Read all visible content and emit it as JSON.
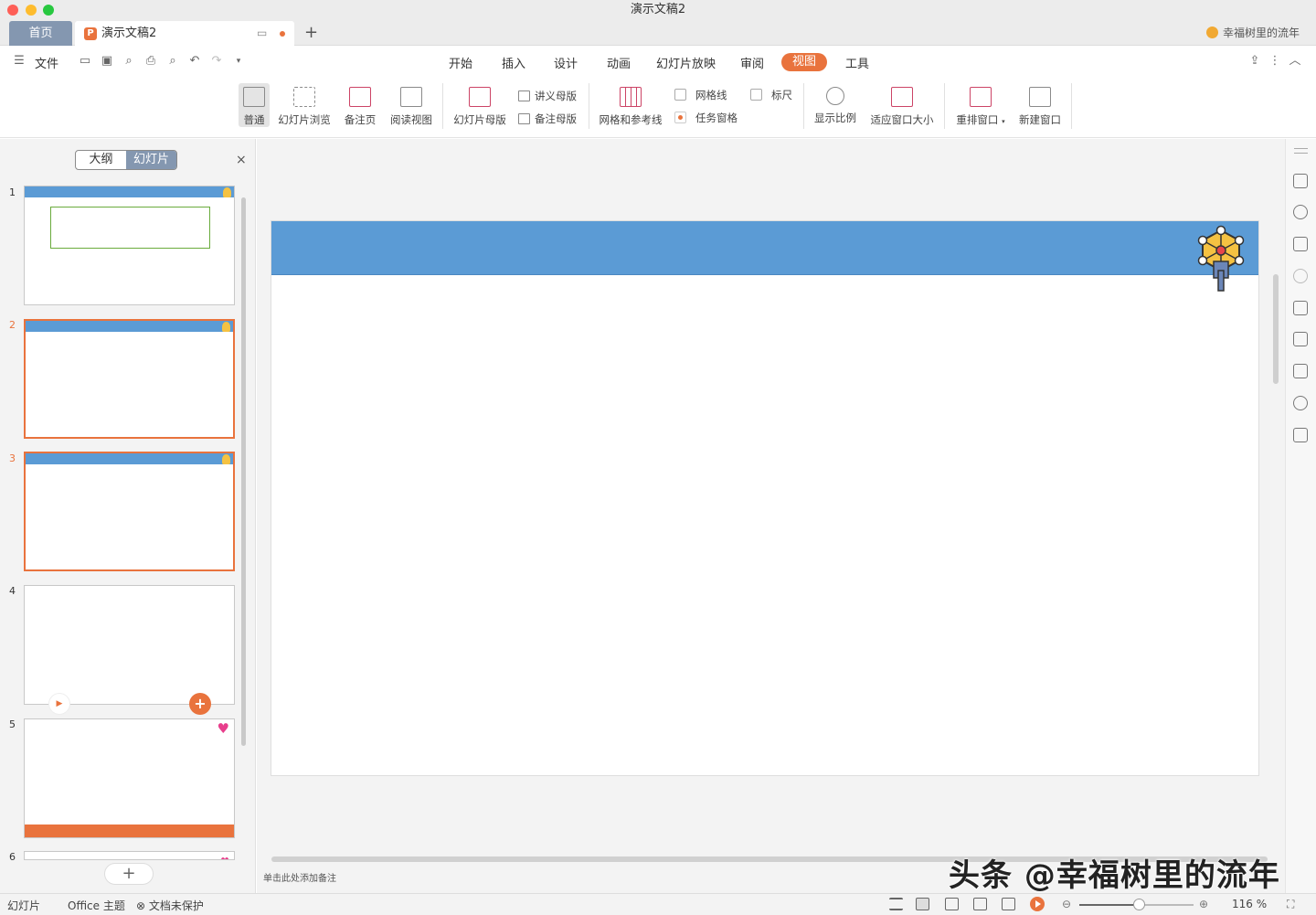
{
  "window": {
    "title": "演示文稿2"
  },
  "tabs": {
    "home": "首页",
    "doc": "演示文稿2",
    "add": "+"
  },
  "user": {
    "name": "幸福树里的流年"
  },
  "menu": {
    "file": "文件",
    "items": [
      "开始",
      "插入",
      "设计",
      "动画",
      "幻灯片放映",
      "审阅",
      "视图",
      "工具"
    ],
    "active": "视图"
  },
  "ribbon": {
    "normal": "普通",
    "slide_sorter": "幻灯片浏览",
    "notes_page": "备注页",
    "reading_view": "阅读视图",
    "slide_master": "幻灯片母版",
    "handout_master": "讲义母版",
    "notes_master": "备注母版",
    "grid_guides": "网格和参考线",
    "gridlines": "网格线",
    "task_pane": "任务窗格",
    "ruler": "标尺",
    "zoom": "显示比例",
    "fit_window": "适应窗口大小",
    "arrange": "重排窗口",
    "new_window": "新建窗口"
  },
  "left_panel": {
    "outline_tab": "大纲",
    "slides_tab": "幻灯片",
    "close": "×",
    "add_slide": "+",
    "slide_numbers": [
      "1",
      "2",
      "3",
      "4",
      "5",
      "6"
    ]
  },
  "notes_placeholder": "单击此处添加备注",
  "status": {
    "mode": "幻灯片",
    "theme": "Office 主题",
    "protect": "文档未保护",
    "zoom": "116 %",
    "zoom_fraction": 0.52
  },
  "watermark": "头条 @幸福树里的流年",
  "colors": {
    "accent": "#e9733d",
    "slide_band": "#5b9bd5",
    "tab_home": "#8497b0"
  }
}
